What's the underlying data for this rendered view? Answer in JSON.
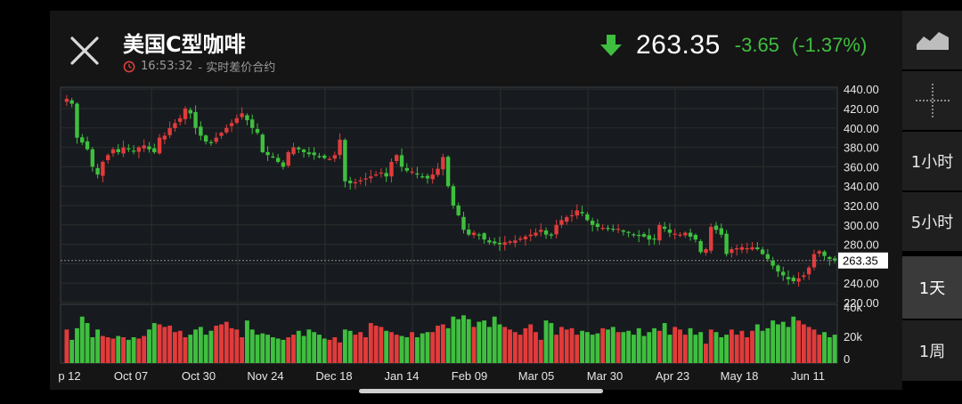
{
  "header": {
    "title": "美国C型咖啡",
    "time": "16:53:32",
    "subtitle": "- 实时差价合约",
    "price": "263.35",
    "change": "-3.65",
    "change_pct": "(-1.37%)"
  },
  "side_panel": {
    "buttons": [
      {
        "label": "",
        "icon": "area-chart-icon"
      },
      {
        "label": "",
        "icon": "crosshair-icon"
      },
      {
        "label": "1小时"
      },
      {
        "label": "5小时"
      },
      {
        "label": "1天"
      },
      {
        "label": "1周"
      }
    ],
    "active": "1天"
  },
  "colors": {
    "up": "#e23b3b",
    "down": "#3fbf3f",
    "grid": "#2c2c2c",
    "background": "#151515"
  },
  "chart_data": {
    "type": "candlestick",
    "current_price": "263.35",
    "y_ticks": [
      "440.00",
      "420.00",
      "400.00",
      "380.00",
      "360.00",
      "340.00",
      "320.00",
      "300.00",
      "280.00",
      "260.00",
      "240.00",
      "220.00"
    ],
    "ylim": [
      220,
      442
    ],
    "volume_ticks": [
      "40k",
      "20k",
      "0"
    ],
    "volume_lim": [
      0,
      40000
    ],
    "x_labels": [
      "p 12",
      "Oct 07",
      "Oct 30",
      "Nov 24",
      "Dec 18",
      "Jan 14",
      "Feb 09",
      "Mar 05",
      "Mar 30",
      "Apr 23",
      "May 18",
      "Jun 11"
    ],
    "close_series": [
      430,
      425,
      390,
      385,
      378,
      360,
      352,
      365,
      372,
      378,
      375,
      380,
      378,
      376,
      380,
      382,
      378,
      375,
      390,
      392,
      400,
      405,
      410,
      420,
      415,
      400,
      392,
      386,
      385,
      390,
      395,
      400,
      405,
      410,
      415,
      408,
      400,
      395,
      375,
      372,
      370,
      365,
      360,
      375,
      380,
      378,
      375,
      373,
      372,
      370,
      369,
      368,
      372,
      388,
      345,
      343,
      344,
      346,
      348,
      350,
      352,
      354,
      350,
      365,
      372,
      360,
      356,
      355,
      352,
      350,
      348,
      352,
      358,
      370,
      340,
      320,
      310,
      295,
      290,
      292,
      290,
      285,
      282,
      281,
      280,
      282,
      283,
      284,
      286,
      288,
      290,
      292,
      295,
      290,
      289,
      300,
      305,
      308,
      310,
      315,
      312,
      305,
      300,
      298,
      297,
      296,
      295,
      296,
      293,
      292,
      290,
      289,
      288,
      285,
      286,
      300,
      296,
      292,
      291,
      290,
      292,
      288,
      285,
      272,
      275,
      298,
      295,
      290,
      270,
      275,
      276,
      277,
      276,
      277,
      275,
      270,
      265,
      258,
      252,
      248,
      244,
      242,
      245,
      248,
      256,
      270,
      273,
      268,
      265,
      263.35
    ],
    "volume": [
      26000,
      18000,
      27000,
      36000,
      31000,
      20000,
      26000,
      21000,
      20000,
      19000,
      21000,
      20000,
      18000,
      20000,
      19000,
      21000,
      26000,
      31000,
      30000,
      28000,
      29000,
      24000,
      25000,
      20000,
      22000,
      26000,
      28000,
      22000,
      25000,
      29000,
      30000,
      32000,
      27000,
      26000,
      20000,
      33000,
      26000,
      22000,
      23000,
      22000,
      20000,
      19000,
      18000,
      20000,
      22000,
      25000,
      21000,
      26000,
      24000,
      22000,
      19000,
      18000,
      20000,
      16000,
      26000,
      25000,
      22000,
      24000,
      20000,
      31000,
      29000,
      28000,
      25000,
      24000,
      22000,
      21000,
      20000,
      24000,
      20000,
      23000,
      24000,
      24000,
      29000,
      30000,
      27000,
      36000,
      34000,
      37000,
      34000,
      28000,
      32000,
      33000,
      28000,
      36000,
      30000,
      28000,
      26000,
      24000,
      22000,
      27000,
      30000,
      24000,
      18000,
      33000,
      31000,
      22000,
      28000,
      26000,
      27000,
      22000,
      25000,
      24000,
      22000,
      23000,
      27000,
      26000,
      28000,
      24000,
      24000,
      25000,
      22000,
      27000,
      21000,
      24000,
      27000,
      25000,
      31000,
      22000,
      28000,
      26000,
      22000,
      27000,
      22000,
      24000,
      15000,
      26000,
      24000,
      20000,
      22000,
      26000,
      22000,
      25000,
      20000,
      25000,
      30000,
      25000,
      27000,
      33000,
      30000,
      32000,
      28000,
      36000,
      33000,
      30000,
      28000,
      26000,
      22000,
      24000,
      20000,
      22000
    ]
  }
}
